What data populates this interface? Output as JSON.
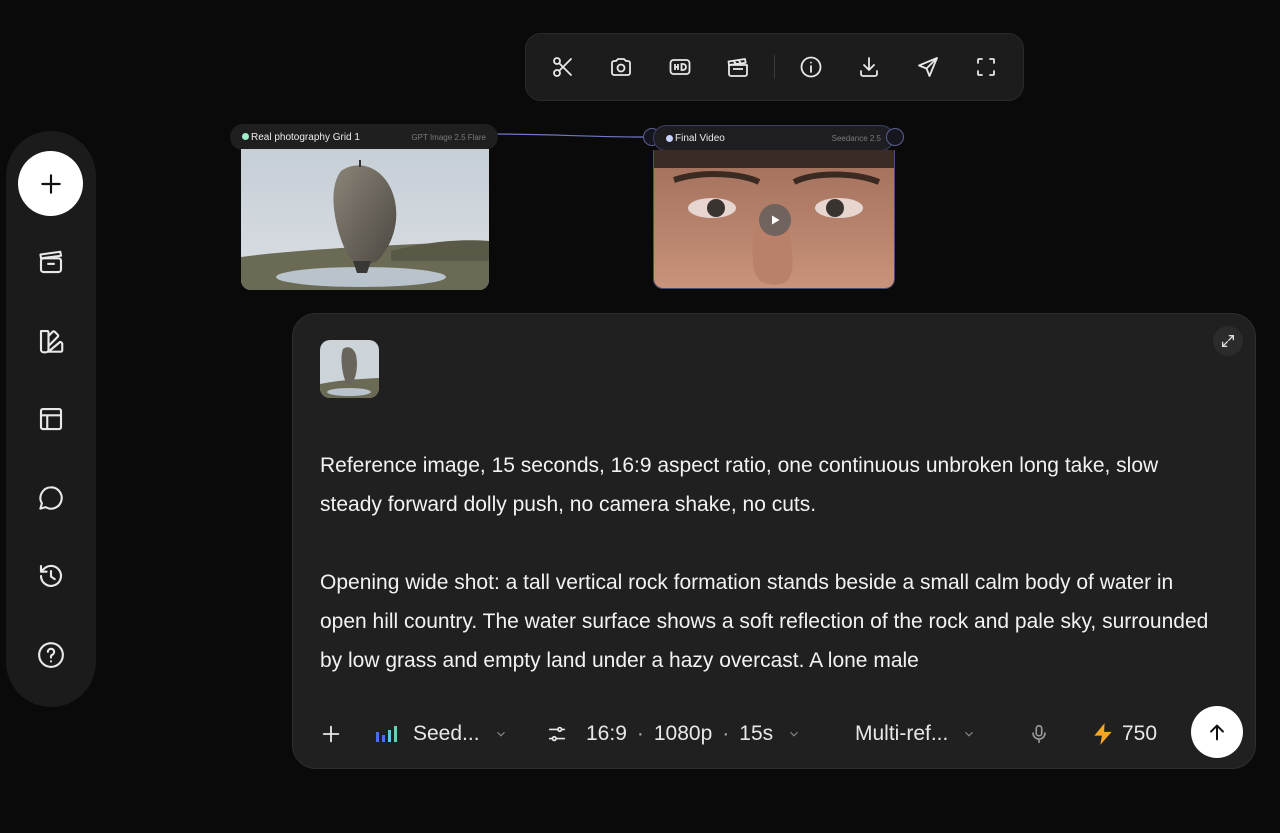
{
  "toolbar": {
    "icons": [
      "scissors-icon",
      "camera-icon",
      "hd-icon",
      "clapperboard-icon",
      "info-icon",
      "download-icon",
      "send-icon",
      "fullscreen-icon"
    ]
  },
  "sidebar": {
    "items": [
      "add-icon",
      "clapperboard-icon",
      "library-icon",
      "layout-icon",
      "chat-icon",
      "history-icon",
      "help-icon"
    ]
  },
  "nodes": [
    {
      "title": "Real photography Grid 1",
      "model": "GPT Image 2.5 Flare",
      "dot_color": "#9ff0c8"
    },
    {
      "title": "Final Video",
      "model": "Seedance 2.5",
      "dot_color": "#c9d3ff"
    }
  ],
  "prompt": {
    "text": "Reference image, 15 seconds, 16:9 aspect ratio, one continuous unbroken long take, slow steady forward dolly push, no camera shake, no cuts.\n\nOpening wide shot: a tall vertical rock formation stands beside a small calm body of water in open hill country. The water surface shows a soft reflection of the rock and pale sky, surrounded by low grass and empty land under a hazy overcast. A lone male"
  },
  "controls": {
    "model_label": "Seed...",
    "aspect": "16:9",
    "resolution": "1080p",
    "duration": "15s",
    "mode_label": "Multi-ref...",
    "credits": "750"
  },
  "colors": {
    "accent_bolt": "#f5a623",
    "model_bars": "#4a6cf7"
  }
}
